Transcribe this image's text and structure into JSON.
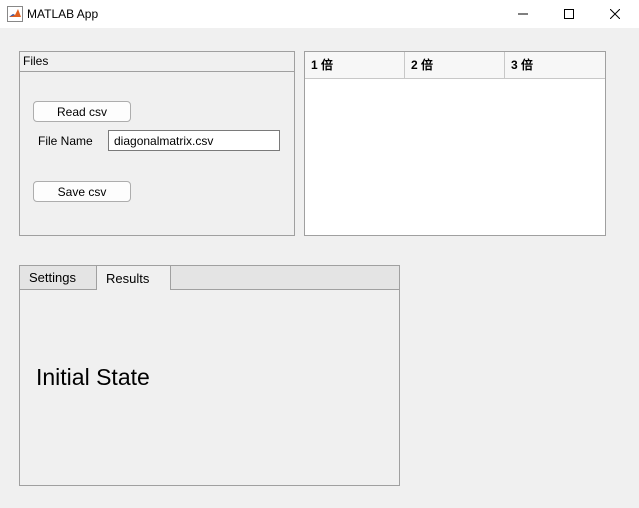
{
  "window": {
    "title": "MATLAB App",
    "controls": [
      "minimize",
      "maximize",
      "close"
    ]
  },
  "files_panel": {
    "title": "Files",
    "read_button": "Read csv",
    "file_name_label": "File Name",
    "file_name_value": "diagonalmatrix.csv",
    "save_button": "Save csv"
  },
  "table": {
    "columns": [
      "1 倍",
      "2 倍",
      "3 倍"
    ],
    "rows": []
  },
  "tabs": {
    "items": [
      {
        "label": "Settings",
        "active": false
      },
      {
        "label": "Results",
        "active": true
      }
    ],
    "results": {
      "status_text": "Initial State"
    }
  },
  "colors": {
    "background": "#f0f0f0",
    "border": "#a0a0a0",
    "table_body": "#ffffff",
    "icon_orange": "#e06020"
  }
}
